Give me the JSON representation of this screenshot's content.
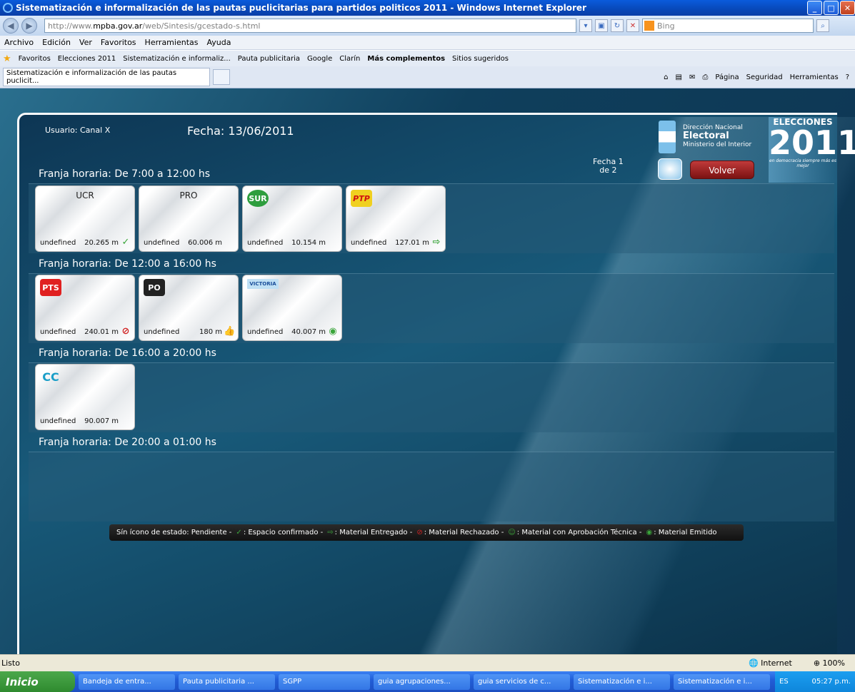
{
  "window": {
    "title": "Sistematización e informalización de las pautas puclicitarias para partidos politicos 2011 - Windows Internet Explorer"
  },
  "address": {
    "url_prefix": "http://www.",
    "url_host": "mpba.gov.ar",
    "url_path": "/web/Sintesis/gcestado-s.html",
    "search_placeholder": "Bing"
  },
  "menu": [
    "Archivo",
    "Edición",
    "Ver",
    "Favoritos",
    "Herramientas",
    "Ayuda"
  ],
  "favorites": {
    "label": "Favoritos",
    "items": [
      "Elecciones 2011",
      "Sistematización e informaliz...",
      "Pauta publicitaria",
      "Google",
      "Clarín",
      "Más complementos",
      "Sitios sugeridos"
    ]
  },
  "tab": {
    "label": "Sistematización e informalización de las pautas puclicit..."
  },
  "commands": [
    "Página",
    "Seguridad",
    "Herramientas"
  ],
  "page": {
    "user": "Usuario: Canal X",
    "date": "Fecha: 13/06/2011",
    "fecha_page_1": "Fecha 1",
    "fecha_page_2": "de 2",
    "dne_1": "Dirección Nacional",
    "dne_2": "Electoral",
    "dne_3": "Ministerio del Interior",
    "elecciones": "ELECCIONES",
    "year": "2011",
    "slogan": "en democracia siempre más es mejor",
    "volver": "Volver"
  },
  "bands": [
    {
      "label": "Franja horaria: De 7:00 a 12:00 hs",
      "cards": [
        {
          "name": "UCR",
          "logo": "",
          "undef": "undefined",
          "val": "20.265 m",
          "status": "confirmado"
        },
        {
          "name": "PRO",
          "logo": "",
          "undef": "undefined",
          "val": "60.006 m",
          "status": ""
        },
        {
          "name": "",
          "logo": "SUR",
          "undef": "undefined",
          "val": "10.154 m",
          "status": ""
        },
        {
          "name": "",
          "logo": "PTP",
          "undef": "undefined",
          "val": "127.01 m",
          "status": "entregado"
        }
      ]
    },
    {
      "label": "Franja horaria: De 12:00 a 16:00 hs",
      "cards": [
        {
          "name": "",
          "logo": "PTS",
          "undef": "undefined",
          "val": "240.01 m",
          "status": "rechazado"
        },
        {
          "name": "",
          "logo": "PO",
          "undef": "undefined",
          "val": "180 m",
          "status": "aprobacion"
        },
        {
          "name": "",
          "logo": "VICTORIA",
          "undef": "undefined",
          "val": "40.007 m",
          "status": "emitido"
        }
      ]
    },
    {
      "label": "Franja horaria: De 16:00 a 20:00 hs",
      "cards": [
        {
          "name": "",
          "logo": "CC",
          "undef": "undefined",
          "val": "90.007 m",
          "status": ""
        }
      ]
    },
    {
      "label": "Franja horaria: De 20:00 a 01:00 hs",
      "cards": []
    }
  ],
  "legend": {
    "pendiente": "Sín ícono de estado: Pendiente  -",
    "confirmado": ": Espacio confirmado  -",
    "entregado": ": Material Entregado  -",
    "rechazado": ": Material Rechazado  -",
    "aprobacion": ": Material con Aprobación Técnica  -",
    "emitido": ": Material Emitido"
  },
  "status": {
    "left": "Listo",
    "zone": "Internet",
    "zoom": "100%"
  },
  "taskbar": {
    "start": "Inicio",
    "items": [
      "Bandeja de entra...",
      "Pauta publicitaria ...",
      "SGPP",
      "guia agrupaciones...",
      "guia servicios de c...",
      "Sistematización e i...",
      "Sistematización e i..."
    ],
    "lang": "ES",
    "clock": "05:27 p.m."
  },
  "colors": {
    "status_green": "#3aa53a",
    "status_red": "#d02020",
    "volver": "#9c2020"
  }
}
